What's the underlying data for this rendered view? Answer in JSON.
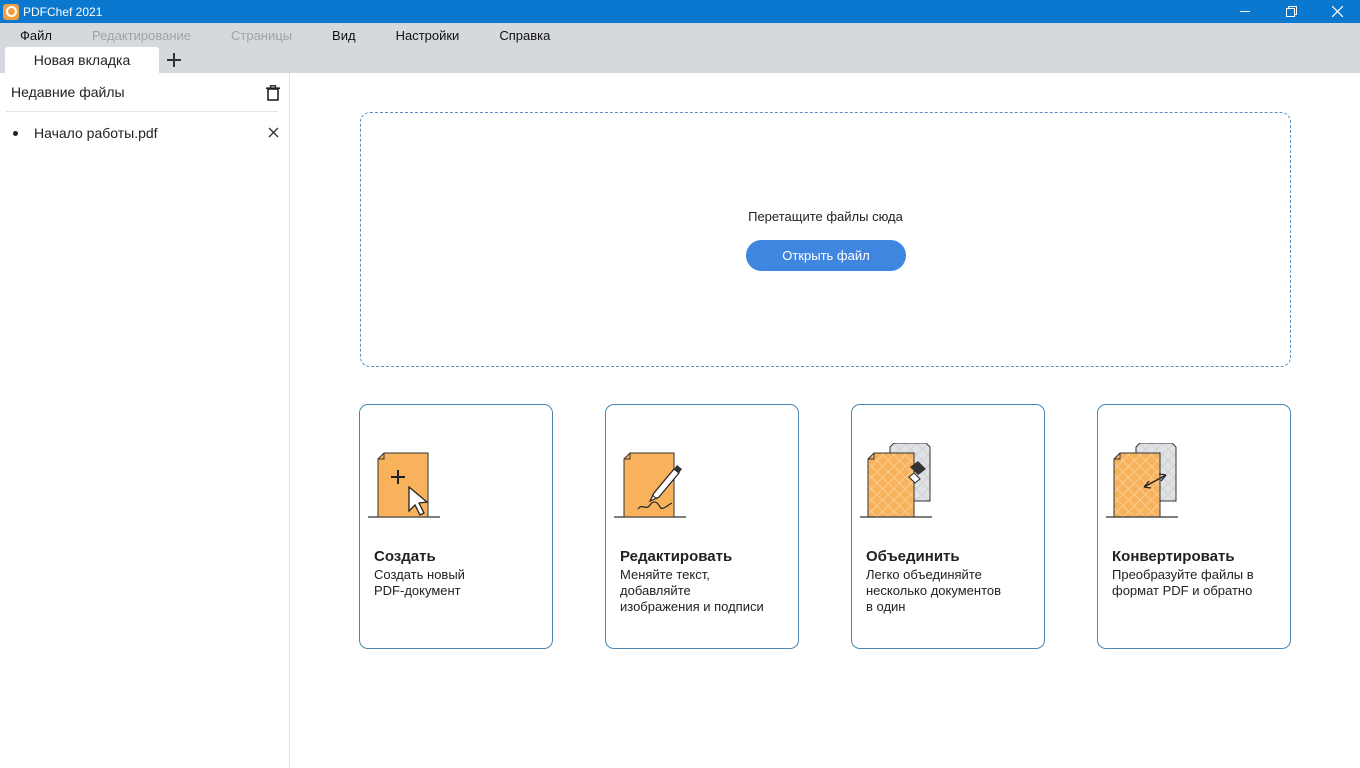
{
  "window": {
    "title": "PDFChef 2021",
    "controls": {
      "minimize": "—",
      "restore": "❐",
      "close": "✕"
    }
  },
  "menu": [
    {
      "label": "Файл",
      "disabled": false
    },
    {
      "label": "Редактирование",
      "disabled": true
    },
    {
      "label": "Страницы",
      "disabled": true
    },
    {
      "label": "Вид",
      "disabled": false
    },
    {
      "label": "Настройки",
      "disabled": false
    },
    {
      "label": "Справка",
      "disabled": false
    }
  ],
  "tabs": {
    "active_label": "Новая вкладка",
    "add_icon": "plus-icon"
  },
  "sidebar": {
    "title": "Недавние файлы",
    "clear_icon": "trash-icon",
    "items": [
      {
        "name": "Начало работы.pdf",
        "remove_icon": "close-icon"
      }
    ]
  },
  "dropzone": {
    "prompt": "Перетащите файлы сюда",
    "open_button": "Открыть файл"
  },
  "cards": [
    {
      "title": "Создать",
      "desc": [
        "Создать новый",
        "PDF-документ"
      ],
      "icon": "create-document-icon"
    },
    {
      "title": "Редактировать",
      "desc": [
        "Меняйте текст,",
        "добавляйте",
        "изображения и подписи"
      ],
      "icon": "edit-document-icon"
    },
    {
      "title": "Объединить",
      "desc": [
        "Легко объединяйте",
        "несколько документов",
        "в один"
      ],
      "icon": "merge-documents-icon"
    },
    {
      "title": "Конвертировать",
      "desc": [
        "Преобразуйте файлы в",
        "формат PDF и обратно"
      ],
      "icon": "convert-documents-icon"
    }
  ],
  "colors": {
    "titlebar": "#0b78d0",
    "menubar": "#d5d8dc",
    "accent_button": "#3f86e0",
    "card_border": "#4a86b0",
    "doc_orange": "#f8b25c"
  }
}
